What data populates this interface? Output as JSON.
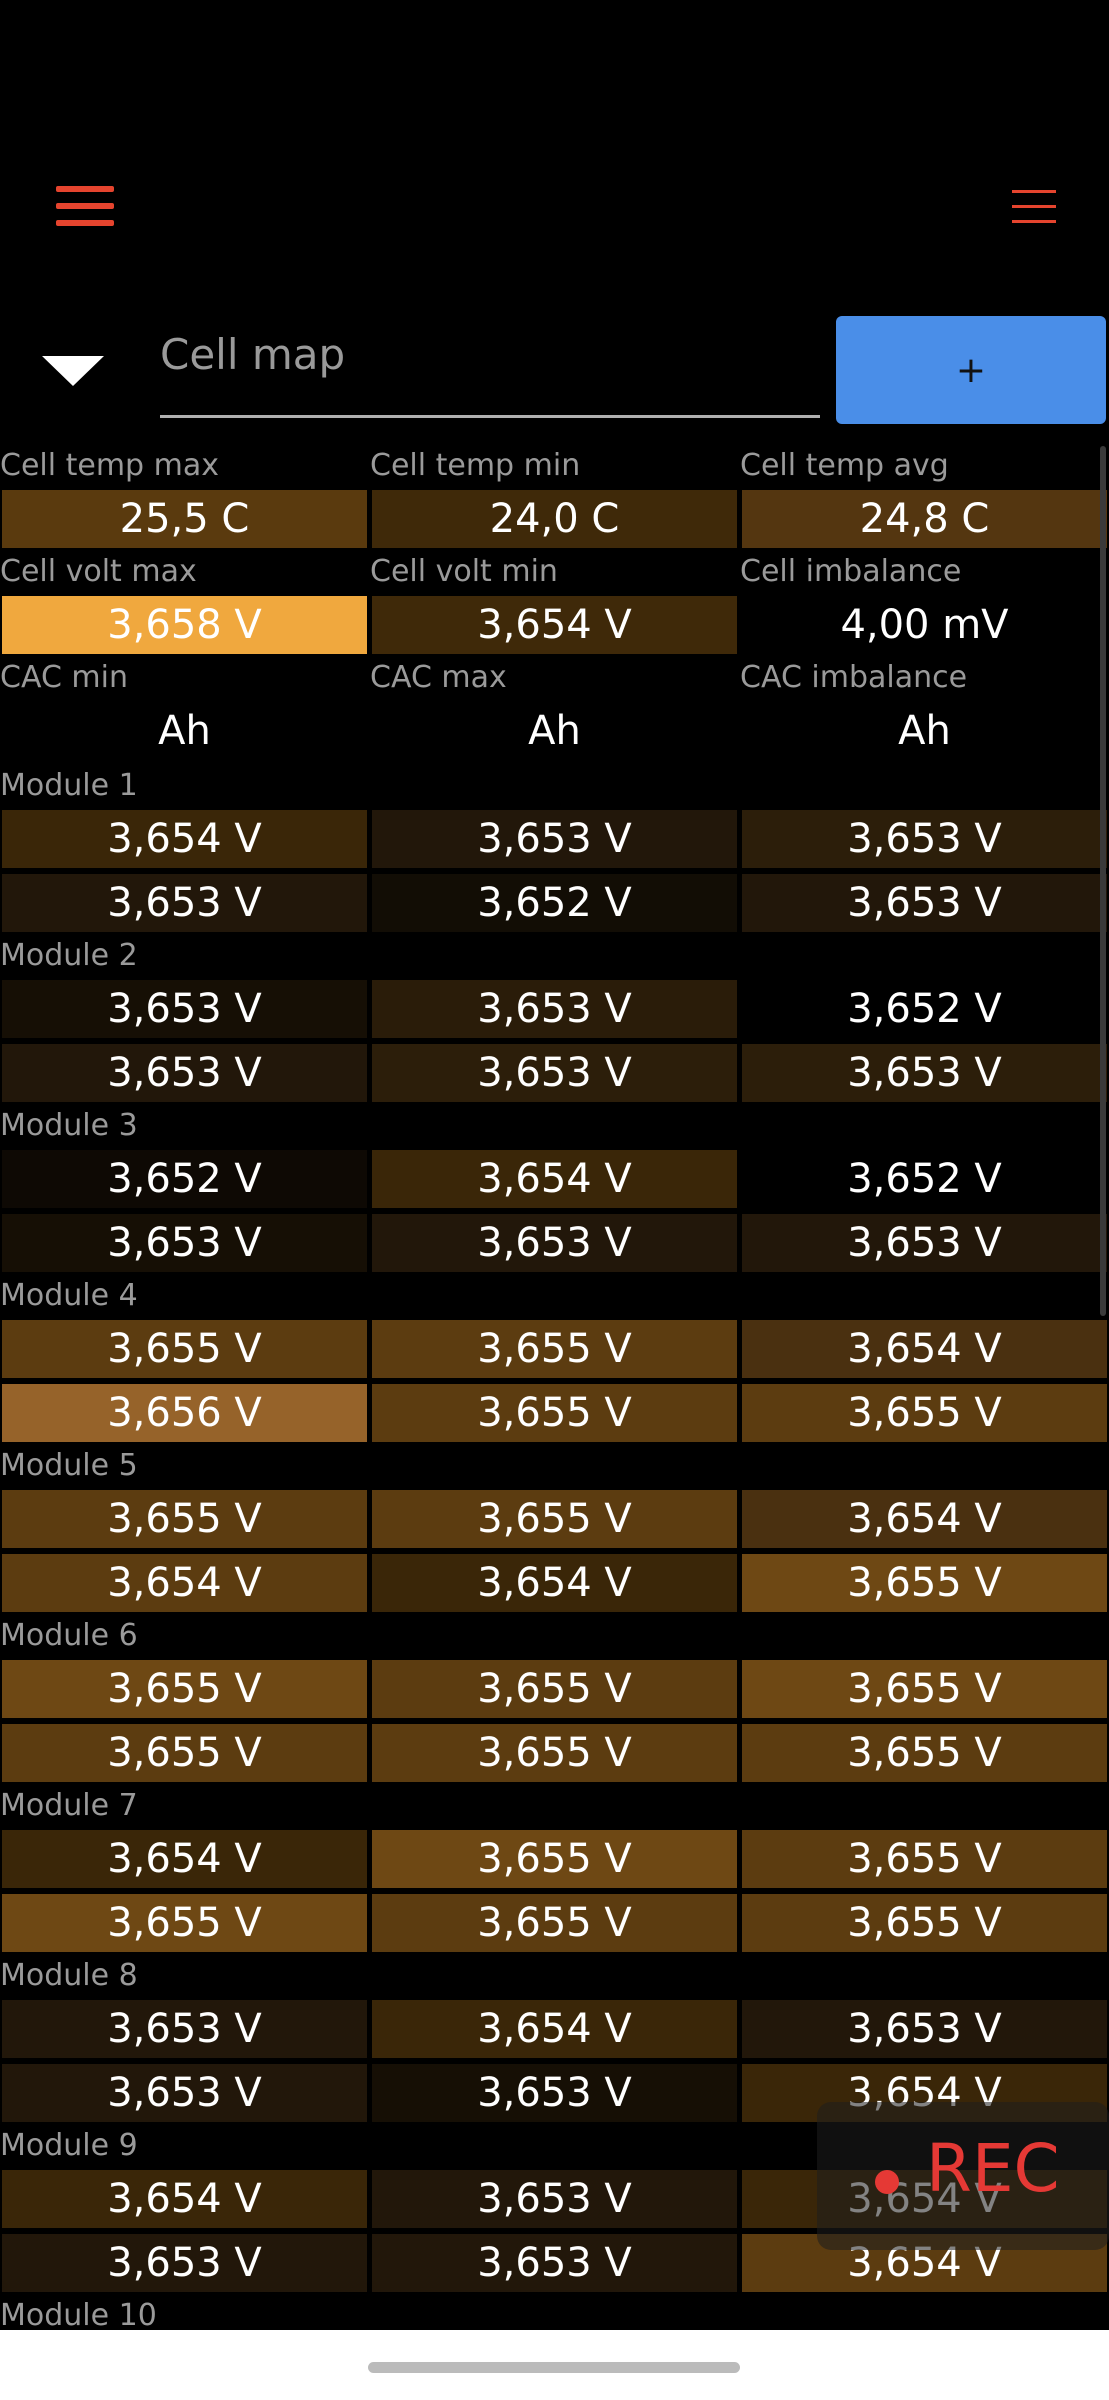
{
  "header": {
    "menu_icon": "hamburger-icon",
    "list_icon": "list-icon"
  },
  "selector": {
    "value": "Cell map",
    "add_label": "+"
  },
  "stats": [
    {
      "label": "Cell temp max",
      "value": "25,5 C",
      "color": "#5a3a0e"
    },
    {
      "label": "Cell temp min",
      "value": "24,0 C",
      "color": "#3f2909"
    },
    {
      "label": "Cell temp avg",
      "value": "24,8 C",
      "color": "#543610"
    },
    {
      "label": "Cell volt max",
      "value": "3,658 V",
      "color": "#f0a83e"
    },
    {
      "label": "Cell volt min",
      "value": "3,654 V",
      "color": "#3f2909"
    },
    {
      "label": "Cell imbalance",
      "value": "4,00 mV",
      "color": "#000000"
    },
    {
      "label": "CAC min",
      "value": "Ah",
      "color": "#000000"
    },
    {
      "label": "CAC max",
      "value": "Ah",
      "color": "#000000"
    },
    {
      "label": "CAC imbalance",
      "value": "Ah",
      "color": "#000000"
    }
  ],
  "modules": [
    {
      "name": "Module 1",
      "cells": [
        {
          "v": "3,654 V",
          "c": "#3a2608"
        },
        {
          "v": "3,653 V",
          "c": "#22170a"
        },
        {
          "v": "3,653 V",
          "c": "#2c1e0a"
        },
        {
          "v": "3,653 V",
          "c": "#22170a"
        },
        {
          "v": "3,652 V",
          "c": "#120d05"
        },
        {
          "v": "3,653 V",
          "c": "#22170a"
        }
      ]
    },
    {
      "name": "Module 2",
      "cells": [
        {
          "v": "3,653 V",
          "c": "#160f05"
        },
        {
          "v": "3,653 V",
          "c": "#2a1c09"
        },
        {
          "v": "3,652 V",
          "c": "#000000"
        },
        {
          "v": "3,653 V",
          "c": "#22170a"
        },
        {
          "v": "3,653 V",
          "c": "#2c1e0a"
        },
        {
          "v": "3,653 V",
          "c": "#2c1e0a"
        }
      ]
    },
    {
      "name": "Module 3",
      "cells": [
        {
          "v": "3,652 V",
          "c": "#0e0904"
        },
        {
          "v": "3,654 V",
          "c": "#3a2608"
        },
        {
          "v": "3,652 V",
          "c": "#000000"
        },
        {
          "v": "3,653 V",
          "c": "#160f05"
        },
        {
          "v": "3,653 V",
          "c": "#22170a"
        },
        {
          "v": "3,653 V",
          "c": "#22170a"
        }
      ]
    },
    {
      "name": "Module 4",
      "cells": [
        {
          "v": "3,655 V",
          "c": "#5c3c10"
        },
        {
          "v": "3,655 V",
          "c": "#5c3c10"
        },
        {
          "v": "3,654 V",
          "c": "#4a3010"
        },
        {
          "v": "3,656 V",
          "c": "#96632a"
        },
        {
          "v": "3,655 V",
          "c": "#5c3c10"
        },
        {
          "v": "3,655 V",
          "c": "#5c3c10"
        }
      ]
    },
    {
      "name": "Module 5",
      "cells": [
        {
          "v": "3,655 V",
          "c": "#5c3c10"
        },
        {
          "v": "3,655 V",
          "c": "#5c3c10"
        },
        {
          "v": "3,654 V",
          "c": "#4a3010"
        },
        {
          "v": "3,654 V",
          "c": "#5c3c10"
        },
        {
          "v": "3,654 V",
          "c": "#3a2608"
        },
        {
          "v": "3,655 V",
          "c": "#6e4814"
        }
      ]
    },
    {
      "name": "Module 6",
      "cells": [
        {
          "v": "3,655 V",
          "c": "#6e4814"
        },
        {
          "v": "3,655 V",
          "c": "#5c3c10"
        },
        {
          "v": "3,655 V",
          "c": "#6e4814"
        },
        {
          "v": "3,655 V",
          "c": "#5c3c10"
        },
        {
          "v": "3,655 V",
          "c": "#5c3c10"
        },
        {
          "v": "3,655 V",
          "c": "#5c3c10"
        }
      ]
    },
    {
      "name": "Module 7",
      "cells": [
        {
          "v": "3,654 V",
          "c": "#3a2608"
        },
        {
          "v": "3,655 V",
          "c": "#6e4814"
        },
        {
          "v": "3,655 V",
          "c": "#5c3c10"
        },
        {
          "v": "3,655 V",
          "c": "#6e4814"
        },
        {
          "v": "3,655 V",
          "c": "#5c3c10"
        },
        {
          "v": "3,655 V",
          "c": "#5c3c10"
        }
      ]
    },
    {
      "name": "Module 8",
      "cells": [
        {
          "v": "3,653 V",
          "c": "#22170a"
        },
        {
          "v": "3,654 V",
          "c": "#3a2608"
        },
        {
          "v": "3,653 V",
          "c": "#22170a"
        },
        {
          "v": "3,653 V",
          "c": "#22170a"
        },
        {
          "v": "3,653 V",
          "c": "#160f05"
        },
        {
          "v": "3,654 V",
          "c": "#3a2608"
        }
      ]
    },
    {
      "name": "Module 9",
      "cells": [
        {
          "v": "3,654 V",
          "c": "#3a2608"
        },
        {
          "v": "3,653 V",
          "c": "#22170a"
        },
        {
          "v": "3,654 V",
          "c": "#3a2608"
        },
        {
          "v": "3,653 V",
          "c": "#22170a"
        },
        {
          "v": "3,653 V",
          "c": "#22170a"
        },
        {
          "v": "3,654 V",
          "c": "#5c3c10"
        }
      ]
    },
    {
      "name": "Module 10",
      "cells": []
    }
  ],
  "rec": {
    "label": "REC",
    "color": "#e53935"
  }
}
